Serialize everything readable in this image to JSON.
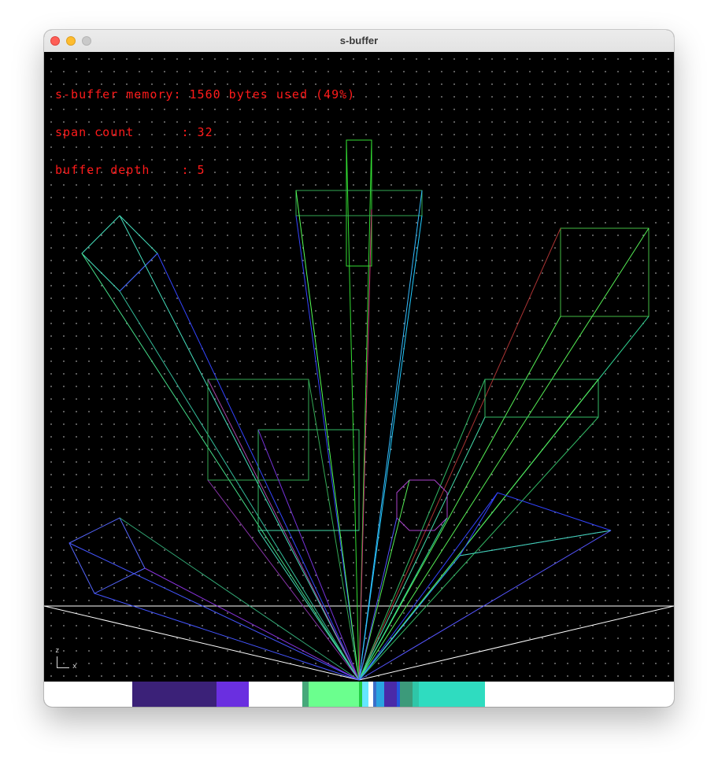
{
  "window": {
    "title": "s-buffer"
  },
  "stats": {
    "memory_line": "s-buffer memory: 1560 bytes used (49%)",
    "span_line": "span count      : 32",
    "depth_line": "buffer depth    : 5"
  },
  "axis": {
    "z": "z",
    "x": "x"
  },
  "colors": {
    "background": "#000000",
    "stats_text": "#ff1a1a",
    "horizon": "#ffffff"
  },
  "icons": [
    "close-icon",
    "minimize-icon",
    "zoom-icon"
  ]
}
